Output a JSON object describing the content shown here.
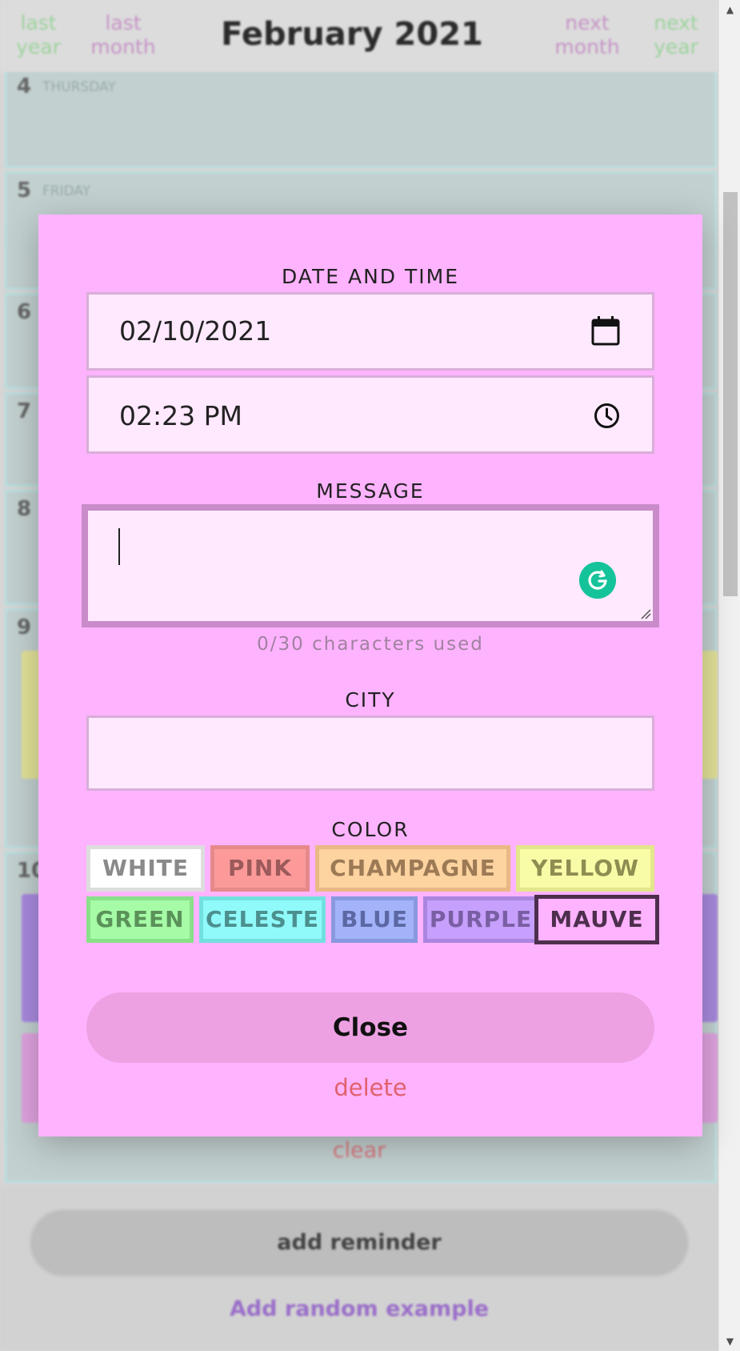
{
  "header": {
    "last_year": "last year",
    "last_month": "last month",
    "title": "February 2021",
    "next_month": "next month",
    "next_year": "next year"
  },
  "calendar": {
    "days": [
      {
        "num": "4",
        "name": "THURSDAY"
      },
      {
        "num": "5",
        "name": "FRIDAY"
      },
      {
        "num": "6"
      },
      {
        "num": "7"
      },
      {
        "num": "8"
      },
      {
        "num": "9"
      },
      {
        "num": "10"
      }
    ],
    "clear_label": "clear",
    "add_reminder_label": "add reminder",
    "add_random_label": "Add random example"
  },
  "modal": {
    "date_time_label": "DATE AND TIME",
    "date_value": "02/10/2021",
    "time_value": "02:23 PM",
    "message_label": "MESSAGE",
    "message_value": "",
    "char_count": "0/30 characters used",
    "city_label": "CITY",
    "city_value": "",
    "color_label": "COLOR",
    "colors": [
      {
        "label": "WHITE",
        "bg": "#ffffff",
        "border": "#dddddd",
        "text": "#8a8a8a",
        "selected": false
      },
      {
        "label": "PINK",
        "bg": "#fc9a9a",
        "border": "#e58a8a",
        "text": "#9c5a5a",
        "selected": false
      },
      {
        "label": "CHAMPAGNE",
        "bg": "#fdd3a0",
        "border": "#e9b985",
        "text": "#9c7a55",
        "selected": false
      },
      {
        "label": "YELLOW",
        "bg": "#f8fca7",
        "border": "#e3e68b",
        "text": "#8e8e52",
        "selected": false
      },
      {
        "label": "GREEN",
        "bg": "#a6fca6",
        "border": "#88e088",
        "text": "#5a925a",
        "selected": false
      },
      {
        "label": "CELESTE",
        "bg": "#8ffaf9",
        "border": "#72e0df",
        "text": "#4c8f8f",
        "selected": false
      },
      {
        "label": "BLUE",
        "bg": "#a2b3fa",
        "border": "#8899e0",
        "text": "#5c68a3",
        "selected": false
      },
      {
        "label": "PURPLE",
        "bg": "#c6a0fc",
        "border": "#ab85e0",
        "text": "#7a5ea3",
        "selected": false
      },
      {
        "label": "MAUVE",
        "bg": "#feb3fe",
        "border": "#4d2f4d",
        "text": "#4d2f4d",
        "selected": true
      }
    ],
    "close_label": "Close",
    "delete_label": "delete"
  },
  "icons": {
    "calendar": "calendar-icon",
    "clock": "clock-icon",
    "grammarly": "grammarly-icon",
    "resize": "resize-handle-icon"
  }
}
